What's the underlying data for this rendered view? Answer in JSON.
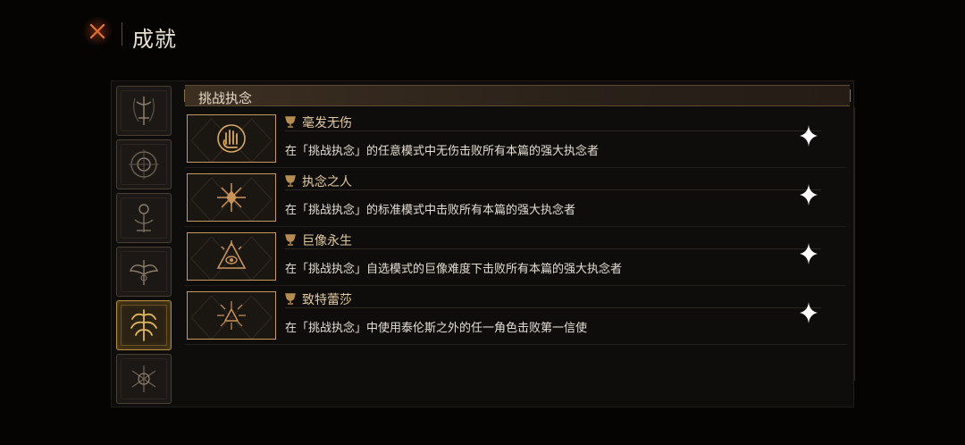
{
  "header": {
    "title": "成就",
    "close_icon": "close-x-icon"
  },
  "sidebar": {
    "tabs": [
      {
        "icon": "sword-emblem-icon",
        "active": false
      },
      {
        "icon": "circle-sigil-icon",
        "active": false
      },
      {
        "icon": "totem-emblem-icon",
        "active": false
      },
      {
        "icon": "winged-crest-icon",
        "active": false
      },
      {
        "icon": "tree-crest-icon",
        "active": true
      },
      {
        "icon": "rune-sigil-icon",
        "active": false
      }
    ]
  },
  "section": {
    "title": "挑战执念"
  },
  "achievements": [
    {
      "title": "毫发无伤",
      "description": "在「挑战执念」的任意模式中无伤击败所有本篇的强大执念者",
      "icon": "hand-sigil-icon",
      "status_icon": "sparkle-icon"
    },
    {
      "title": "执念之人",
      "description": "在「挑战执念」的标准模式中击败所有本篇的强大执念者",
      "icon": "star-burst-icon",
      "status_icon": "sparkle-icon"
    },
    {
      "title": "巨像永生",
      "description": "在「挑战执念」自选模式的巨像难度下击败所有本篇的强大执念者",
      "icon": "eye-triangle-icon",
      "status_icon": "sparkle-icon"
    },
    {
      "title": "致特蕾莎",
      "description": "在「挑战执念」中使用泰伦斯之外的任一角色击败第一信使",
      "icon": "rune-triangle-icon",
      "status_icon": "sparkle-icon"
    }
  ],
  "colors": {
    "accent_gold": "#c79a5c",
    "title_text": "#e0c9a0",
    "close_orange": "#e07030"
  }
}
